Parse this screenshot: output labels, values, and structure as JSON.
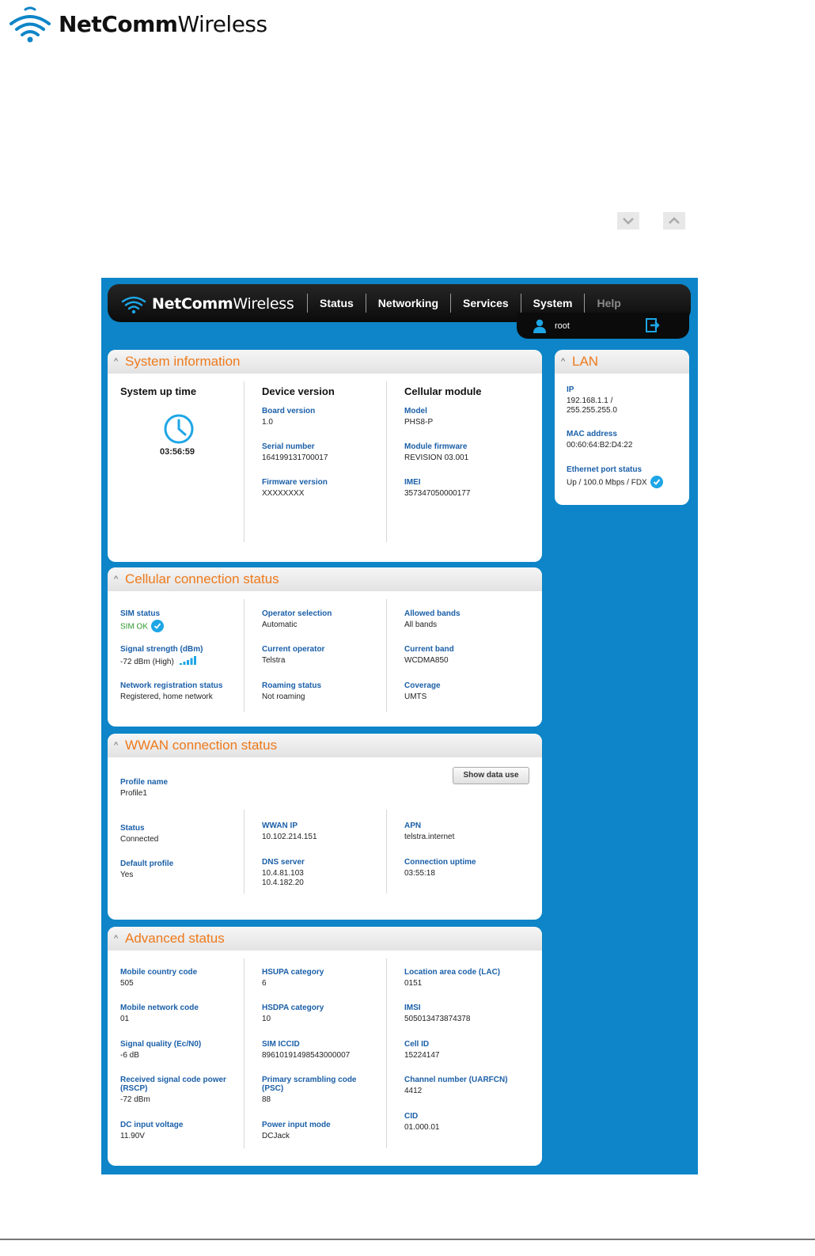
{
  "doc": {
    "brand_bold": "NetComm",
    "brand_light": "Wireless"
  },
  "topbar": {
    "brand_bold": "NetComm",
    "brand_light": "Wireless",
    "nav": [
      "Status",
      "Networking",
      "Services",
      "System",
      "Help"
    ],
    "user": "root"
  },
  "system_info": {
    "title": "System information",
    "uptime_heading": "System up time",
    "uptime": "03:56:59",
    "device_heading": "Device version",
    "cellular_heading": "Cellular module",
    "device_fields": [
      {
        "label": "Board version",
        "value": "1.0"
      },
      {
        "label": "Serial number",
        "value": "164199131700017"
      },
      {
        "label": "Firmware version",
        "value": "XXXXXXXX"
      }
    ],
    "cellular_fields": [
      {
        "label": "Model",
        "value": "PHS8-P"
      },
      {
        "label": "Module firmware",
        "value": "REVISION 03.001"
      },
      {
        "label": "IMEI",
        "value": "357347050000177"
      }
    ]
  },
  "lan": {
    "title": "LAN",
    "ip_label": "IP",
    "ip_value": "192.168.1.1 /",
    "ip_mask": "255.255.255.0",
    "mac_label": "MAC address",
    "mac_value": "00:60:64:B2:D4:22",
    "eth_label": "Ethernet port status",
    "eth_value": "Up / 100.0 Mbps / FDX"
  },
  "cellular": {
    "title": "Cellular connection status",
    "sim_label": "SIM status",
    "sim_value": "SIM OK",
    "signal_label": "Signal strength (dBm)",
    "signal_value": "-72 dBm (High)",
    "netreg_label": "Network registration status",
    "netreg_value": "Registered, home network",
    "col2": [
      {
        "label": "Operator selection",
        "value": "Automatic"
      },
      {
        "label": "Current operator",
        "value": "Telstra"
      },
      {
        "label": "Roaming status",
        "value": "Not roaming"
      }
    ],
    "col3": [
      {
        "label": "Allowed bands",
        "value": "All bands"
      },
      {
        "label": "Current band",
        "value": "WCDMA850"
      },
      {
        "label": "Coverage",
        "value": "UMTS"
      }
    ],
    "colors": {
      "sim_ok": "#2e9a2e"
    }
  },
  "wwan": {
    "title": "WWAN connection status",
    "profile_label": "Profile name",
    "profile_value": "Profile1",
    "show_data_button": "Show data use",
    "status_label": "Status",
    "status_value": "Connected",
    "default_label": "Default profile",
    "default_value": "Yes",
    "wwan_ip_label": "WWAN IP",
    "wwan_ip_value": "10.102.214.151",
    "dns_label": "DNS server",
    "dns_value_1": "10.4.81.103",
    "dns_value_2": "10.4.182.20",
    "apn_label": "APN",
    "apn_value": "telstra.internet",
    "uptime_label": "Connection uptime",
    "uptime_value": "03:55:18"
  },
  "advanced": {
    "title": "Advanced status",
    "col1": [
      {
        "label": "Mobile country code",
        "value": "505"
      },
      {
        "label": "Mobile network code",
        "value": "01"
      },
      {
        "label": "Signal quality (Ec/N0)",
        "value": "-6 dB"
      },
      {
        "label": "Received signal code power",
        "label2": "(RSCP)",
        "value": "-72 dBm"
      },
      {
        "label": "DC input voltage",
        "value": "11.90V"
      }
    ],
    "col2": [
      {
        "label": "HSUPA category",
        "value": "6"
      },
      {
        "label": "HSDPA category",
        "value": "10"
      },
      {
        "label": "SIM ICCID",
        "value": "89610191498543000007"
      },
      {
        "label": "Primary scrambling code",
        "label2": "(PSC)",
        "value": "88"
      },
      {
        "label": "Power input mode",
        "value": "DCJack"
      }
    ],
    "col3": [
      {
        "label": "Location area code (LAC)",
        "value": "0151"
      },
      {
        "label": "IMSI",
        "value": "505013473874378"
      },
      {
        "label": "Cell ID",
        "value": "15224147"
      },
      {
        "label": "Channel number (UARFCN)",
        "value": "4412"
      },
      {
        "label": "CID",
        "value": "01.000.01"
      }
    ]
  },
  "colors": {
    "frame_blue": "#0d85c8",
    "title_orange": "#ee7a1c",
    "label_blue": "#1a5fa8",
    "check_blue": "#1da6e6"
  }
}
